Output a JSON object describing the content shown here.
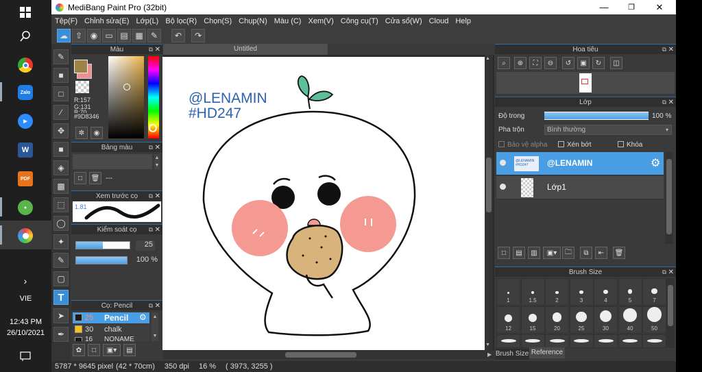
{
  "taskbar": {
    "lang": "VIE",
    "time": "12:43 PM",
    "date": "26/10/2021",
    "apps": [
      "windows-logo",
      "search",
      "chrome",
      "zalo",
      "zoom",
      "word",
      "pdf",
      "game",
      "medibang"
    ],
    "zalo_label": "Zalo",
    "pdf_label": "PDF",
    "word_label": "W"
  },
  "window": {
    "title": "MediBang Paint Pro (32bit)",
    "minimize": "—",
    "maximize": "❐",
    "close": "✕"
  },
  "menu": [
    "Tệp(F)",
    "Chỉnh sửa(E)",
    "Lớp(L)",
    "Bộ lọc(R)",
    "Chọn(S)",
    "Chụp(N)",
    "Màu (C)",
    "Xem(V)",
    "Công cụ(T)",
    "Cửa sổ(W)",
    "Cloud",
    "Help"
  ],
  "document": {
    "tab": "Untitled"
  },
  "color_panel": {
    "title": "Màu",
    "r": "R:157",
    "g": "G:131",
    "b": "B:70",
    "hex": "#9D8346",
    "fg": "#9d8346",
    "bg": "#f08f8f"
  },
  "palette_panel": {
    "title": "Bảng màu",
    "dash": "---"
  },
  "preview_panel": {
    "title": "Xem trước cọ",
    "size": "1.81"
  },
  "brush_control": {
    "title": "Kiểm soát cọ",
    "size_value": "25",
    "opacity_value": "100 %",
    "size_fraction": 0.5,
    "opacity_fraction": 1.0
  },
  "brush_list": {
    "title": "Cọ: Pencil",
    "items": [
      {
        "size": "25",
        "name": "Pencil",
        "color": "#1a1a1a"
      },
      {
        "size": "30",
        "name": "chalk",
        "color": "#f4c518"
      },
      {
        "size": "16",
        "name": "NONAME",
        "color": "#1a1a1a"
      }
    ]
  },
  "navigator": {
    "title": "Hoa tiêu"
  },
  "layer_panel": {
    "title": "Lớp",
    "opacity_label": "Độ trong",
    "opacity_value": "100 %",
    "opacity_fraction": 1.0,
    "blend_label": "Pha trộn",
    "blend_value": "Bình thường",
    "alpha_lock": "Bảo vệ alpha",
    "clipping": "Xén bớt",
    "lock": "Khóa",
    "layers": [
      {
        "name": "@LENAMIN",
        "selected": true
      },
      {
        "name": "Lớp1",
        "selected": false
      }
    ]
  },
  "brush_size_panel": {
    "title": "Brush Size",
    "sizes": [
      "1",
      "1.5",
      "2",
      "3",
      "4",
      "5",
      "7",
      "12",
      "15",
      "20",
      "25",
      "30",
      "40",
      "50"
    ],
    "tabs": [
      "Brush Size",
      "Reference"
    ]
  },
  "artwork": {
    "line1": "@LENAMIN",
    "line2": "#HD247",
    "text_color": "#2a64b0",
    "leaf_color": "#5cbf9a",
    "cheek_color": "#f59a92",
    "cookie_color": "#d8b47c"
  },
  "status": {
    "pixels": "5787 * 9645 pixel",
    "cm": "(42 * 70cm)",
    "dpi": "350 dpi",
    "zoom": "16 %",
    "coords": "( 3973, 3255 )"
  }
}
